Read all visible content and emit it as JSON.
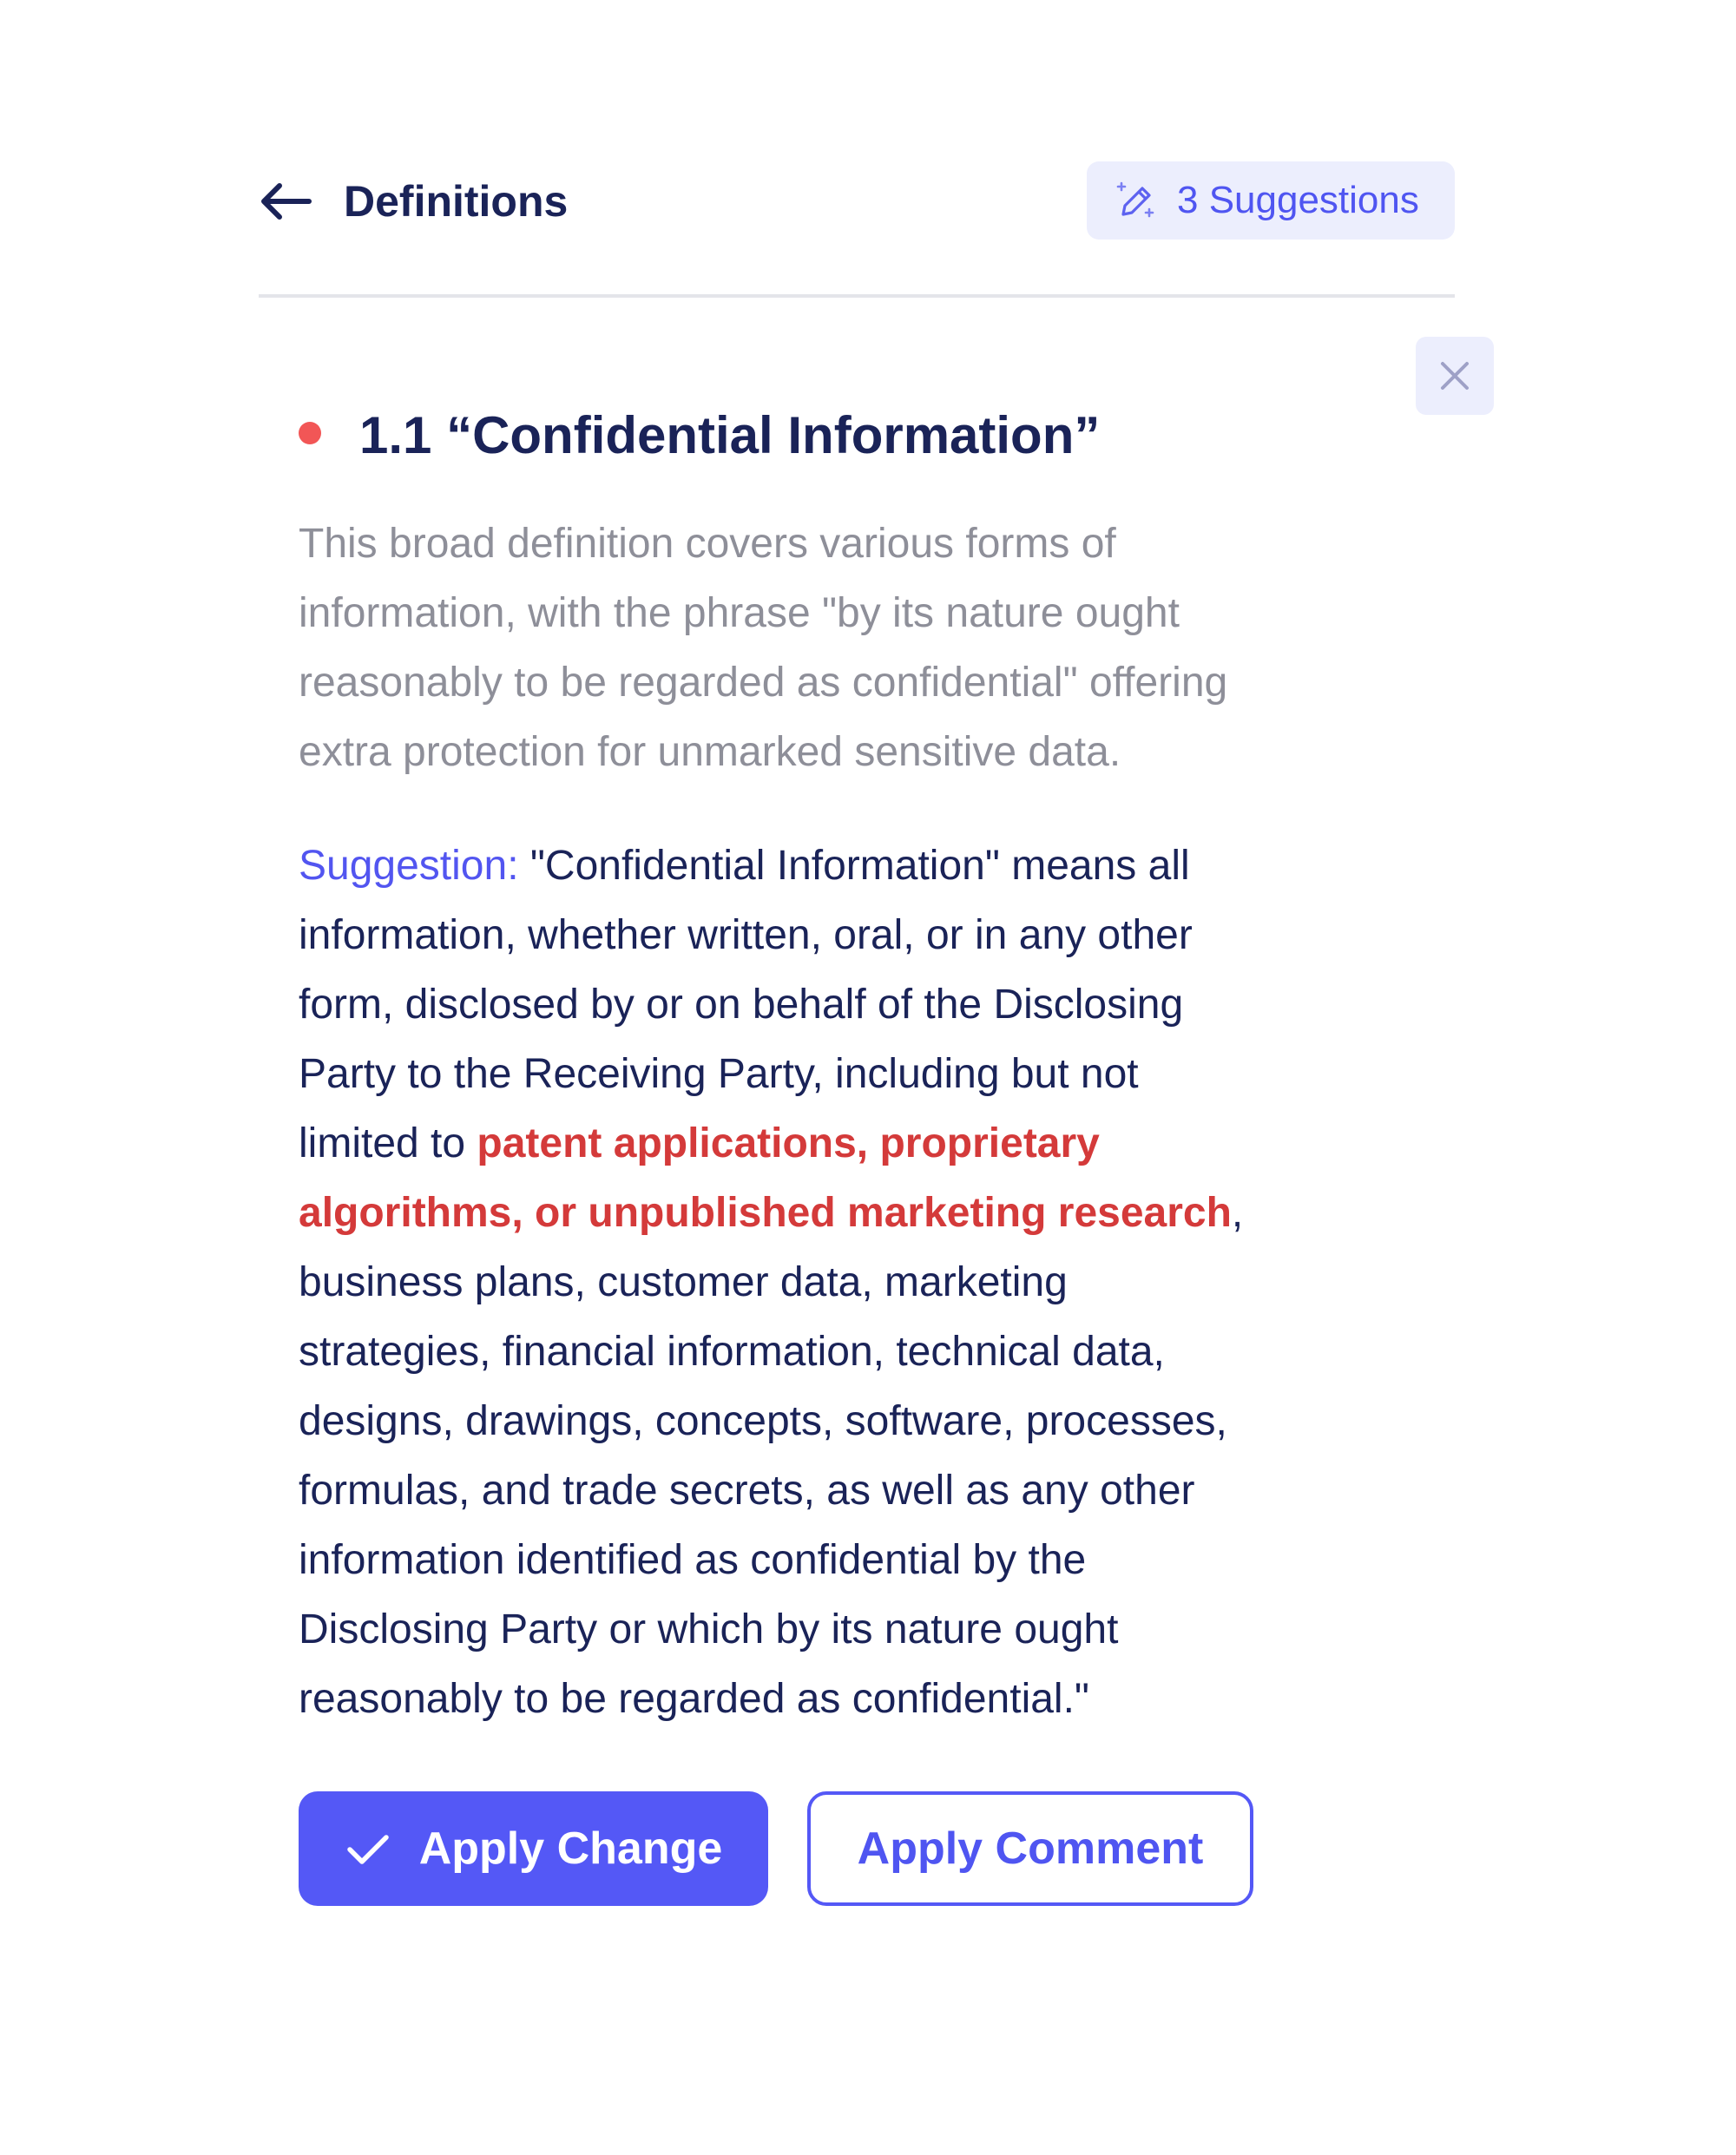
{
  "header": {
    "title": "Definitions",
    "back_icon": "arrow-left-icon",
    "suggestions_label": "3 Suggestions",
    "suggestions_icon": "magic-pen-icon"
  },
  "close_icon": "close-icon",
  "section": {
    "title": "1.1 “Confidential Information”",
    "status_color": "#f25656",
    "description_lines": [
      "This broad definition covers various forms of",
      "information, with the phrase \"by its nature ought",
      "reasonably to be regarded as confidential\" offering",
      "extra protection for unmarked sensitive data."
    ]
  },
  "suggestion": {
    "label": "Suggestion:",
    "line1_rest": " \"Confidential Information\" means all",
    "line2": "information, whether written, oral, or in any other",
    "line3": "form, disclosed by or on behalf of the Disclosing",
    "line4": "Party to the Receiving Party, including but not",
    "line5_prefix": "limited to ",
    "line5_highlight": "patent applications, proprietary",
    "line6_highlight": "algorithms, or unpublished marketing research",
    "line6_suffix": ",",
    "line7": "business plans, customer data, marketing",
    "line8": "strategies, financial information, technical data,",
    "line9": "designs, drawings, concepts, software, processes,",
    "line10": "formulas, and trade secrets, as well as any other",
    "line11": "information identified as confidential by the",
    "line12": "Disclosing Party or which by its nature ought",
    "line13": "reasonably to be regarded as confidential.\""
  },
  "actions": {
    "apply_change_label": "Apply Change",
    "apply_change_icon": "check-icon",
    "apply_comment_label": "Apply Comment"
  },
  "colors": {
    "accent": "#5458f6",
    "text_primary": "#1a2358",
    "text_muted": "#8e8f99",
    "highlight": "#d43a3a",
    "badge_bg": "#eceefd"
  }
}
